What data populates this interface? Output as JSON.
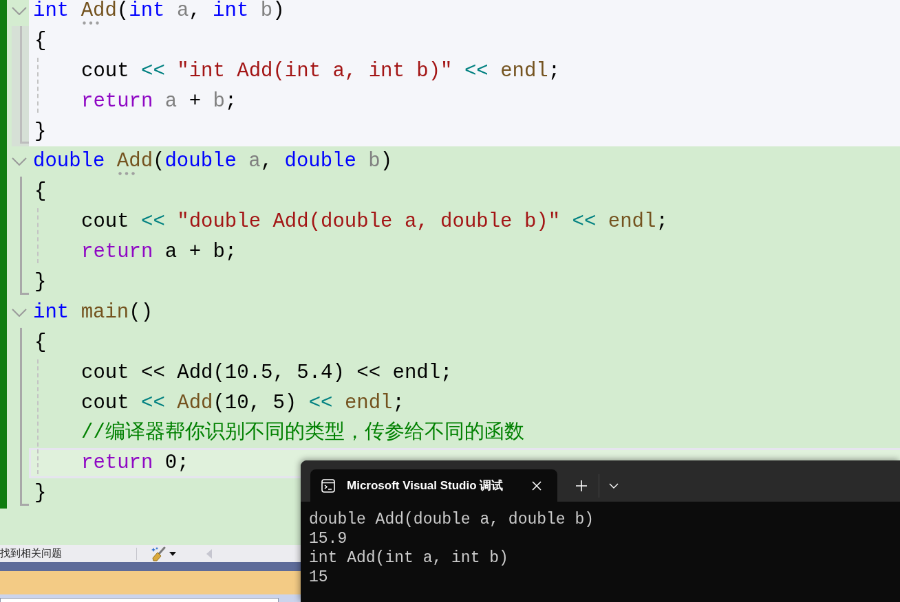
{
  "editor": {
    "blocks": [
      {
        "expanded": true,
        "hovered": true,
        "header": [
          {
            "text": "int ",
            "kind": "keyword"
          },
          {
            "text": "Add",
            "kind": "function",
            "suggestion": true
          },
          {
            "text": "(",
            "kind": "plain"
          },
          {
            "text": "int ",
            "kind": "keyword"
          },
          {
            "text": "a",
            "kind": "param"
          },
          {
            "text": ", ",
            "kind": "plain"
          },
          {
            "text": "int ",
            "kind": "keyword"
          },
          {
            "text": "b",
            "kind": "param"
          },
          {
            "text": ")",
            "kind": "plain"
          }
        ],
        "open": "{",
        "body": [
          {
            "current": false,
            "tokens": [
              {
                "text": "cout ",
                "kind": "plain"
              },
              {
                "text": "<< ",
                "kind": "operator"
              },
              {
                "text": "\"int Add(int a, int b)\"",
                "kind": "string"
              },
              {
                "text": " << ",
                "kind": "operator"
              },
              {
                "text": "endl",
                "kind": "function"
              },
              {
                "text": ";",
                "kind": "plain"
              }
            ]
          },
          {
            "current": false,
            "tokens": [
              {
                "text": "return ",
                "kind": "control"
              },
              {
                "text": "a",
                "kind": "param"
              },
              {
                "text": " + ",
                "kind": "plain"
              },
              {
                "text": "b",
                "kind": "param"
              },
              {
                "text": ";",
                "kind": "plain"
              }
            ]
          }
        ],
        "close": "}"
      },
      {
        "expanded": true,
        "hovered": false,
        "header": [
          {
            "text": "double ",
            "kind": "keyword"
          },
          {
            "text": "Add",
            "kind": "function",
            "suggestion": true
          },
          {
            "text": "(",
            "kind": "plain"
          },
          {
            "text": "double ",
            "kind": "keyword"
          },
          {
            "text": "a",
            "kind": "param"
          },
          {
            "text": ", ",
            "kind": "plain"
          },
          {
            "text": "double ",
            "kind": "keyword"
          },
          {
            "text": "b",
            "kind": "param"
          },
          {
            "text": ")",
            "kind": "plain"
          }
        ],
        "open": "{",
        "body": [
          {
            "current": false,
            "tokens": [
              {
                "text": "cout ",
                "kind": "plain"
              },
              {
                "text": "<< ",
                "kind": "operator"
              },
              {
                "text": "\"double Add(double a, double b)\"",
                "kind": "string"
              },
              {
                "text": " << ",
                "kind": "operator"
              },
              {
                "text": "endl",
                "kind": "function"
              },
              {
                "text": ";",
                "kind": "plain"
              }
            ]
          },
          {
            "current": false,
            "tokens": [
              {
                "text": "return ",
                "kind": "control"
              },
              {
                "text": "a + b;",
                "kind": "plain"
              }
            ]
          }
        ],
        "close": "}"
      },
      {
        "expanded": true,
        "hovered": false,
        "header": [
          {
            "text": "int ",
            "kind": "keyword"
          },
          {
            "text": "main",
            "kind": "function"
          },
          {
            "text": "()",
            "kind": "plain"
          }
        ],
        "open": "{",
        "body": [
          {
            "current": false,
            "tokens": [
              {
                "text": "cout << Add(10.5, 5.4) << endl;",
                "kind": "plain"
              }
            ]
          },
          {
            "current": false,
            "tokens": [
              {
                "text": "cout ",
                "kind": "plain"
              },
              {
                "text": "<< ",
                "kind": "operator"
              },
              {
                "text": "Add",
                "kind": "function"
              },
              {
                "text": "(10, 5) ",
                "kind": "plain"
              },
              {
                "text": "<< ",
                "kind": "operator"
              },
              {
                "text": "endl",
                "kind": "function"
              },
              {
                "text": ";",
                "kind": "plain"
              }
            ]
          },
          {
            "current": false,
            "tokens": [
              {
                "text": "//编译器帮你识别不同的类型，传参给不同的函数",
                "kind": "comment"
              }
            ]
          },
          {
            "current": true,
            "tokens": [
              {
                "text": "return ",
                "kind": "control"
              },
              {
                "text": "0;",
                "kind": "plain"
              }
            ]
          }
        ],
        "close": "}"
      }
    ]
  },
  "status_bar": {
    "issues_text": "找到相关问题",
    "scroll_left": {
      "disabled": true
    }
  },
  "terminal": {
    "tabs": [
      {
        "title": "Microsoft Visual Studio 调试",
        "selected": true
      }
    ],
    "output": [
      "double Add(double a, double b)",
      "15.9",
      "int Add(int a, int b)",
      "15"
    ]
  }
}
